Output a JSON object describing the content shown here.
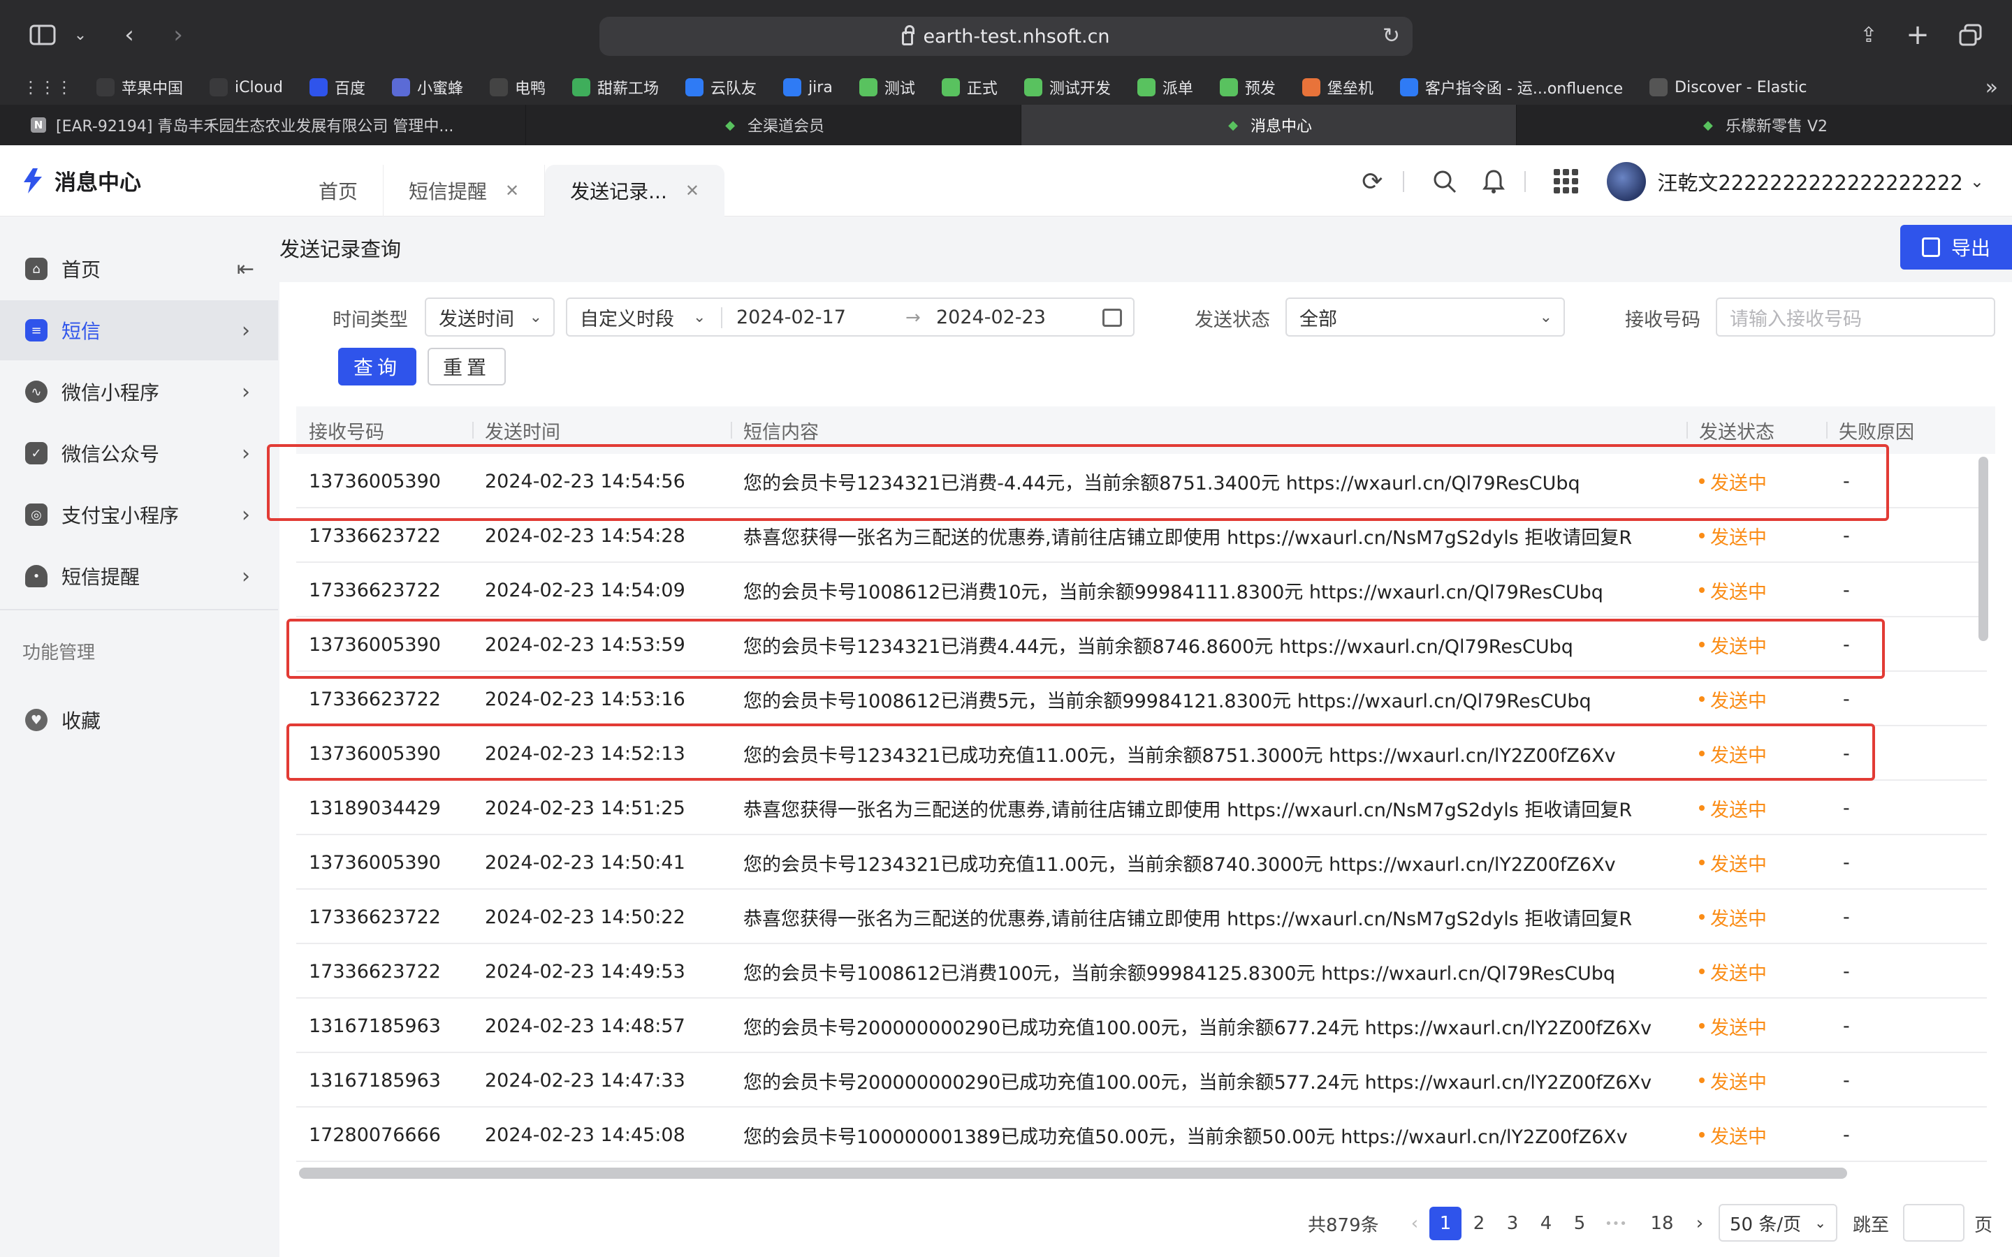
{
  "browser": {
    "url": "earth-test.nhsoft.cn",
    "bookmarks": [
      {
        "label": "苹果中国",
        "icon": "apple-icon",
        "color": "#3a3a3c"
      },
      {
        "label": "iCloud",
        "icon": "apple-icon",
        "color": "#3a3a3c"
      },
      {
        "label": "百度",
        "icon": "baidu-paw-icon",
        "color": "#2f54eb"
      },
      {
        "label": "小蜜蜂",
        "icon": "bee-icon",
        "color": "#5b6bd6"
      },
      {
        "label": "电鸭",
        "icon": "duck-icon",
        "color": "#444"
      },
      {
        "label": "甜薪工场",
        "icon": "tianxin-icon",
        "color": "#3fae5b"
      },
      {
        "label": "云队友",
        "icon": "yunduiyou-icon",
        "color": "#2f7bf5"
      },
      {
        "label": "jira",
        "icon": "jira-icon",
        "color": "#2f7bf5"
      },
      {
        "label": "测试",
        "icon": "nhsoft-icon",
        "color": "#59c25f"
      },
      {
        "label": "正式",
        "icon": "nhsoft-icon",
        "color": "#59c25f"
      },
      {
        "label": "测试开发",
        "icon": "nhsoft-icon",
        "color": "#59c25f"
      },
      {
        "label": "派单",
        "icon": "nhsoft-icon",
        "color": "#59c25f"
      },
      {
        "label": "预发",
        "icon": "nhsoft-icon",
        "color": "#59c25f"
      },
      {
        "label": "堡垒机",
        "icon": "bastion-icon",
        "color": "#e8733a"
      },
      {
        "label": "客户指令函 - 运...onfluence",
        "icon": "confluence-icon",
        "color": "#2f7bf5"
      },
      {
        "label": "Discover - Elastic",
        "icon": "globe-icon",
        "color": "#555"
      }
    ],
    "tabs": [
      {
        "label": "[EAR-92194] 青岛丰禾园生态农业发展有限公司 管理中...",
        "icon": "N"
      },
      {
        "label": "全渠道会员",
        "icon": "◆"
      },
      {
        "label": "消息中心",
        "icon": "◆"
      },
      {
        "label": "乐檬新零售 V2",
        "icon": "◆"
      }
    ]
  },
  "app": {
    "brand": "消息中心",
    "page_tabs": [
      "首页",
      "短信提醒",
      "发送记录..."
    ],
    "user_name": "汪乾文2222222222222222222"
  },
  "sidebar": {
    "items": [
      "首页",
      "短信",
      "微信小程序",
      "微信公众号",
      "支付宝小程序",
      "短信提醒"
    ],
    "group_label": "功能管理",
    "favorites": "收藏"
  },
  "page": {
    "title": "发送记录查询",
    "export_label": "导出"
  },
  "filters": {
    "time_type_label": "时间类型",
    "time_type_value": "发送时间",
    "period_value": "自定义时段",
    "date_start": "2024-02-17",
    "date_end": "2024-02-23",
    "range_arrow": "→",
    "status_label": "发送状态",
    "status_value": "全部",
    "phone_label": "接收号码",
    "phone_placeholder": "请输入接收号码",
    "query_label": "查询",
    "reset_label": "重置"
  },
  "table": {
    "columns": [
      "接收号码",
      "发送时间",
      "短信内容",
      "发送状态",
      "失败原因"
    ],
    "rows": [
      {
        "phone": "13736005390",
        "time": "2024-02-23 14:54:56",
        "content": "您的会员卡号1234321已消费-4.44元，当前余额8751.3400元 https://wxaurl.cn/Ql79ResCUbq",
        "status": "发送中",
        "reason": "-"
      },
      {
        "phone": "17336623722",
        "time": "2024-02-23 14:54:28",
        "content": "恭喜您获得一张名为三配送的优惠券,请前往店铺立即使用 https://wxaurl.cn/NsM7gS2dyls 拒收请回复R",
        "status": "发送中",
        "reason": "-"
      },
      {
        "phone": "17336623722",
        "time": "2024-02-23 14:54:09",
        "content": "您的会员卡号1008612已消费10元，当前余额99984111.8300元 https://wxaurl.cn/Ql79ResCUbq",
        "status": "发送中",
        "reason": "-"
      },
      {
        "phone": "13736005390",
        "time": "2024-02-23 14:53:59",
        "content": "您的会员卡号1234321已消费4.44元，当前余额8746.8600元 https://wxaurl.cn/Ql79ResCUbq",
        "status": "发送中",
        "reason": "-"
      },
      {
        "phone": "17336623722",
        "time": "2024-02-23 14:53:16",
        "content": "您的会员卡号1008612已消费5元，当前余额99984121.8300元 https://wxaurl.cn/Ql79ResCUbq",
        "status": "发送中",
        "reason": "-"
      },
      {
        "phone": "13736005390",
        "time": "2024-02-23 14:52:13",
        "content": "您的会员卡号1234321已成功充值11.00元，当前余额8751.3000元 https://wxaurl.cn/lY2Z00fZ6Xv",
        "status": "发送中",
        "reason": "-"
      },
      {
        "phone": "13189034429",
        "time": "2024-02-23 14:51:25",
        "content": "恭喜您获得一张名为三配送的优惠券,请前往店铺立即使用 https://wxaurl.cn/NsM7gS2dyls 拒收请回复R",
        "status": "发送中",
        "reason": "-"
      },
      {
        "phone": "13736005390",
        "time": "2024-02-23 14:50:41",
        "content": "您的会员卡号1234321已成功充值11.00元，当前余额8740.3000元 https://wxaurl.cn/lY2Z00fZ6Xv",
        "status": "发送中",
        "reason": "-"
      },
      {
        "phone": "17336623722",
        "time": "2024-02-23 14:50:22",
        "content": "恭喜您获得一张名为三配送的优惠券,请前往店铺立即使用 https://wxaurl.cn/NsM7gS2dyls 拒收请回复R",
        "status": "发送中",
        "reason": "-"
      },
      {
        "phone": "17336623722",
        "time": "2024-02-23 14:49:53",
        "content": "您的会员卡号1008612已消费100元，当前余额99984125.8300元 https://wxaurl.cn/Ql79ResCUbq",
        "status": "发送中",
        "reason": "-"
      },
      {
        "phone": "13167185963",
        "time": "2024-02-23 14:48:57",
        "content": "您的会员卡号200000000290已成功充值100.00元，当前余额677.24元 https://wxaurl.cn/lY2Z00fZ6Xv",
        "status": "发送中",
        "reason": "-"
      },
      {
        "phone": "13167185963",
        "time": "2024-02-23 14:47:33",
        "content": "您的会员卡号200000000290已成功充值100.00元，当前余额577.24元 https://wxaurl.cn/lY2Z00fZ6Xv",
        "status": "发送中",
        "reason": "-"
      },
      {
        "phone": "17280076666",
        "time": "2024-02-23 14:45:08",
        "content": "您的会员卡号100000001389已成功充值50.00元，当前余额50.00元 https://wxaurl.cn/lY2Z00fZ6Xv",
        "status": "发送中",
        "reason": "-"
      }
    ]
  },
  "pagination": {
    "total": "共879条",
    "pages": [
      "1",
      "2",
      "3",
      "4",
      "5"
    ],
    "ellipsis": "•••",
    "last_page": "18",
    "current": "1",
    "page_size": "50 条/页",
    "jump_label": "跳至",
    "page_suffix": "页"
  },
  "colors": {
    "primary": "#2f54eb",
    "status_sending": "#fa8c16",
    "highlight_box": "#e23b35"
  }
}
